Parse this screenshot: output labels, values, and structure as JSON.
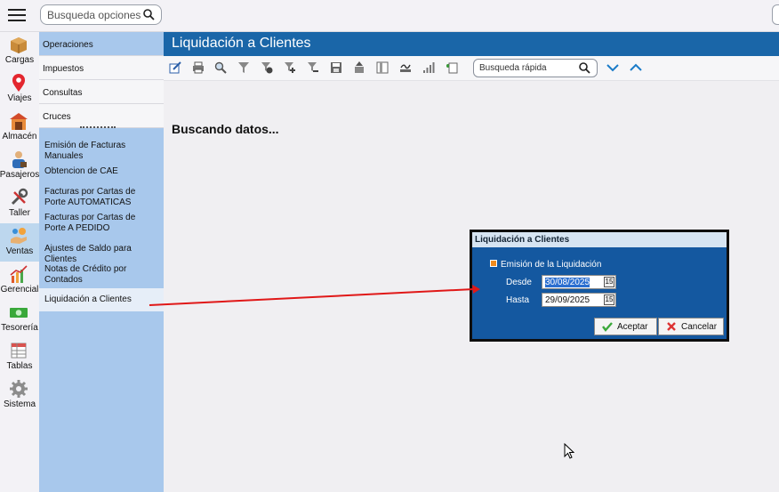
{
  "top": {
    "search_placeholder": "Busqueda opciones"
  },
  "rail": [
    {
      "label": "Cargas",
      "icon": "box-icon"
    },
    {
      "label": "Viajes",
      "icon": "map-pin-icon"
    },
    {
      "label": "Almacén",
      "icon": "warehouse-icon"
    },
    {
      "label": "Pasajeros",
      "icon": "passenger-icon"
    },
    {
      "label": "Taller",
      "icon": "wrench-icon"
    },
    {
      "label": "Ventas",
      "icon": "sales-icon",
      "active": true
    },
    {
      "label": "Gerencial",
      "icon": "chart-icon"
    },
    {
      "label": "Tesorería",
      "icon": "money-icon"
    },
    {
      "label": "Tablas",
      "icon": "table-icon"
    },
    {
      "label": "Sistema",
      "icon": "gear-icon"
    }
  ],
  "submenu": {
    "categories": [
      "Operaciones",
      "Impuestos",
      "Consultas",
      "Cruces"
    ],
    "items": [
      "Emisión de Facturas Manuales",
      "Obtencion de CAE",
      "Facturas por Cartas de Porte AUTOMATICAS",
      "Facturas por Cartas de Porte A PEDIDO",
      "Ajustes de Saldo para Clientes",
      "Notas de Crédito por Contados",
      "Liquidación a Clientes"
    ]
  },
  "main": {
    "title": "Liquidación a Clientes",
    "quick_search_placeholder": "Busqueda rápida",
    "status": "Buscando datos..."
  },
  "dialog": {
    "title": "Liquidación a Clientes",
    "checkbox_label": "Emisión de la Liquidación",
    "desde_label": "Desde",
    "desde_value": "30/08/2025",
    "hasta_label": "Hasta",
    "hasta_value": "29/09/2025",
    "calendar_glyph": "15",
    "accept_label": "Aceptar",
    "cancel_label": "Cancelar"
  },
  "colors": {
    "title_bar": "#1a66a8",
    "submenu_bg": "#a8c8ec",
    "dialog_bg": "#1458a0",
    "arrow": "#e01818"
  }
}
